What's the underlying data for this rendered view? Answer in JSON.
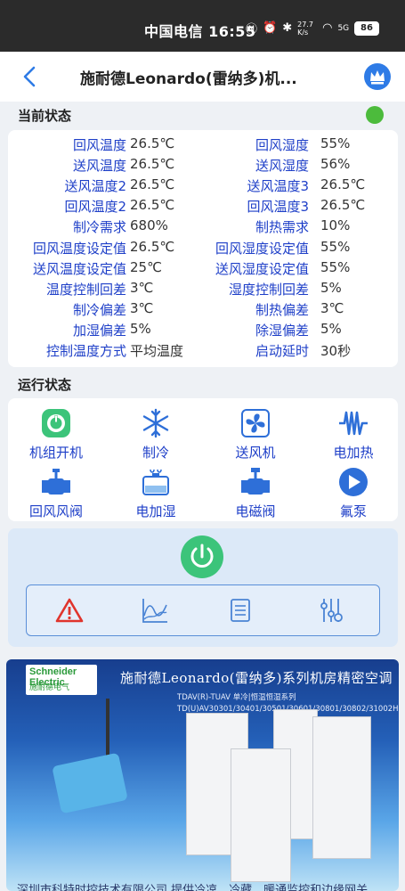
{
  "status_bar": {
    "carrier_time": "中国电信 16:55",
    "speed": "27.7 K/s",
    "network": "5G",
    "battery": "86"
  },
  "header": {
    "title": "施耐德Leonardo(雷纳多)机..."
  },
  "current_status": {
    "label": "当前状态",
    "indicator_color": "#4cbb3c",
    "rows": [
      {
        "l1": "回风温度",
        "v1": "26.5℃",
        "l2": "回风湿度",
        "v2": "55%"
      },
      {
        "l1": "送风温度",
        "v1": "26.5℃",
        "l2": "送风湿度",
        "v2": "56%"
      },
      {
        "l1": "送风温度2",
        "v1": "26.5℃",
        "l2": "送风温度3",
        "v2": "26.5℃"
      },
      {
        "l1": "回风温度2",
        "v1": "26.5℃",
        "l2": "回风温度3",
        "v2": "26.5℃"
      },
      {
        "l1": "制冷需求",
        "v1": "680%",
        "l2": "制热需求",
        "v2": "10%"
      },
      {
        "l1": "回风温度设定值",
        "v1": "26.5℃",
        "l2": "回风湿度设定值",
        "v2": "55%"
      },
      {
        "l1": "送风温度设定值",
        "v1": "25℃",
        "l2": "送风湿度设定值",
        "v2": "55%"
      },
      {
        "l1": "温度控制回差",
        "v1": "3℃",
        "l2": "湿度控制回差",
        "v2": "5%"
      },
      {
        "l1": "制冷偏差",
        "v1": "3℃",
        "l2": "制热偏差",
        "v2": "3℃"
      },
      {
        "l1": "加湿偏差",
        "v1": "5%",
        "l2": "除湿偏差",
        "v2": "5%"
      },
      {
        "l1": "控制温度方式",
        "v1": "平均温度",
        "l2": "启动延时",
        "v2": "30秒"
      }
    ]
  },
  "run_status": {
    "label": "运行状态",
    "items": [
      {
        "label": "机组开机",
        "icon": "power-on-icon",
        "color": "#3cc47a"
      },
      {
        "label": "制冷",
        "icon": "snowflake-icon",
        "color": "#2e6fd8"
      },
      {
        "label": "送风机",
        "icon": "fan-icon",
        "color": "#2e6fd8"
      },
      {
        "label": "电加热",
        "icon": "heater-icon",
        "color": "#2e6fd8"
      },
      {
        "label": "回风风阀",
        "icon": "valve-icon",
        "color": "#2e6fd8"
      },
      {
        "label": "电加湿",
        "icon": "humidifier-icon",
        "color": "#2e6fd8"
      },
      {
        "label": "电磁阀",
        "icon": "solenoid-valve-icon",
        "color": "#2e6fd8"
      },
      {
        "label": "氟泵",
        "icon": "pump-icon",
        "color": "#2e6fd8"
      }
    ]
  },
  "controls": {
    "power_color": "#3cc47a",
    "tools": [
      "alarm-icon",
      "chart-icon",
      "list-icon",
      "settings-icon"
    ]
  },
  "banner": {
    "brand_name": "Schneider Electric",
    "brand_sub": "施耐德电气",
    "title": "施耐德Leonardo(雷纳多)系列机房精密空调",
    "sub1": "TDAV(R)-TUAV 单冷|恒温恒湿系列",
    "sub2": "TD(U)AV30301/30401/30501/30601/30801/30802/31002H(C)",
    "footer": "深圳市科特时控技术有限公司   提供冷凉、冷藏、暖通监控和边缘网关"
  }
}
